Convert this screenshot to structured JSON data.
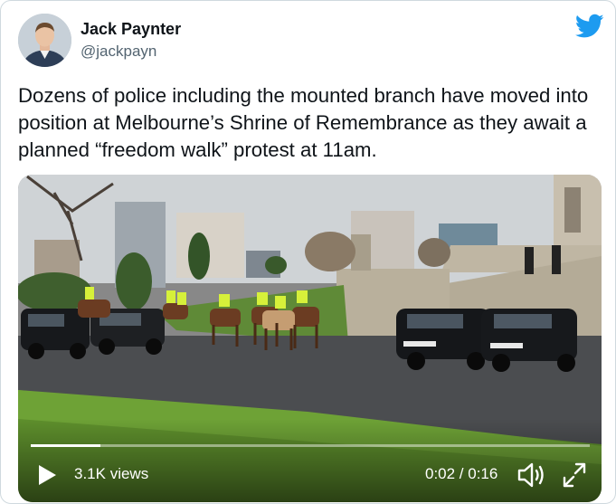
{
  "author": {
    "display_name": "Jack Paynter",
    "handle": "@jackpayn",
    "avatar_icon": "person-avatar"
  },
  "brand": {
    "icon": "twitter-bird-icon",
    "color": "#1d9bf0"
  },
  "tweet": {
    "text": "Dozens of police including the mounted branch have moved into position at Melbourne’s Shrine of Remembrance as they await a planned “freedom walk” protest at 11am."
  },
  "video": {
    "views": "3.1K views",
    "time": "0:02 / 0:16",
    "progress_fraction": 0.125,
    "play_icon": "play-icon",
    "volume_icon": "volume-icon",
    "fullscreen_icon": "fullscreen-icon"
  }
}
